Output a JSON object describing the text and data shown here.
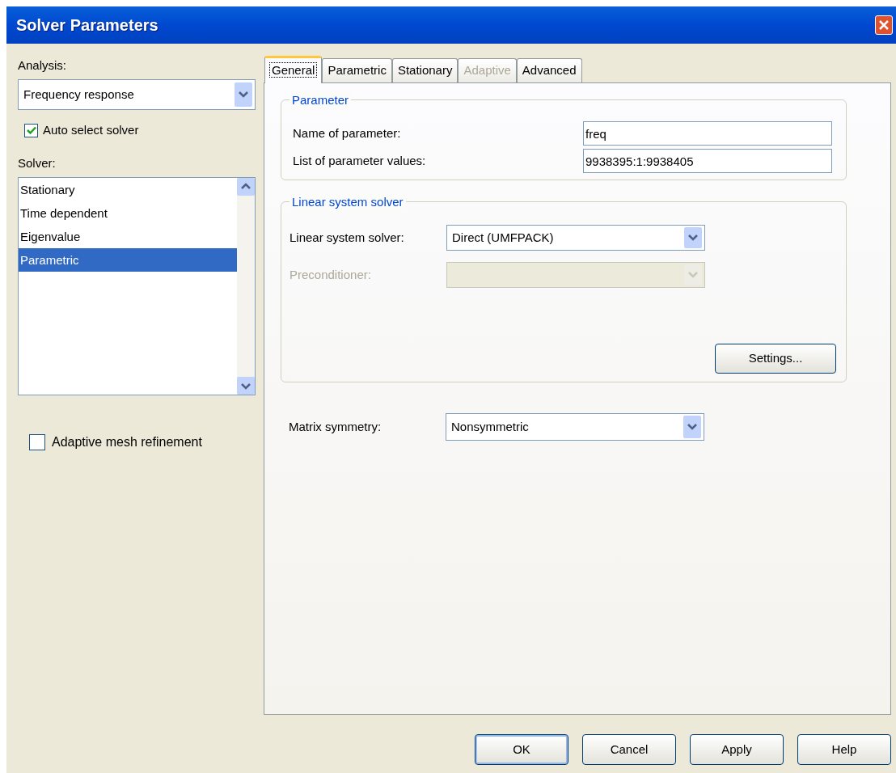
{
  "window": {
    "title": "Solver Parameters"
  },
  "analysis": {
    "label": "Analysis:",
    "value": "Frequency response"
  },
  "auto_select": {
    "label": "Auto select solver",
    "checked": true
  },
  "solver": {
    "label": "Solver:",
    "items": [
      {
        "label": "Stationary",
        "selected": false
      },
      {
        "label": "Time dependent",
        "selected": false
      },
      {
        "label": "Eigenvalue",
        "selected": false
      },
      {
        "label": "Parametric",
        "selected": true
      }
    ]
  },
  "adaptive_mesh": {
    "label": "Adaptive mesh refinement",
    "checked": false
  },
  "tabs": [
    {
      "label": "General",
      "selected": true,
      "disabled": false
    },
    {
      "label": "Parametric",
      "selected": false,
      "disabled": false
    },
    {
      "label": "Stationary",
      "selected": false,
      "disabled": false
    },
    {
      "label": "Adaptive",
      "selected": false,
      "disabled": true
    },
    {
      "label": "Advanced",
      "selected": false,
      "disabled": false
    }
  ],
  "parameter_group": {
    "title": "Parameter",
    "fields": [
      {
        "label": "Name of parameter:",
        "value": "freq"
      },
      {
        "label": "List of parameter values:",
        "value": "9938395:1:9938405"
      }
    ]
  },
  "linear_group": {
    "title": "Linear system solver",
    "rows": [
      {
        "label": "Linear system solver:",
        "value": "Direct (UMFPACK)",
        "disabled": false
      },
      {
        "label": "Preconditioner:",
        "disabled": true
      }
    ],
    "settings_button": "Settings..."
  },
  "matrix_symmetry": {
    "label": "Matrix symmetry:",
    "value": "Nonsymmetric"
  },
  "buttons": [
    "OK",
    "Cancel",
    "Apply",
    "Help"
  ]
}
